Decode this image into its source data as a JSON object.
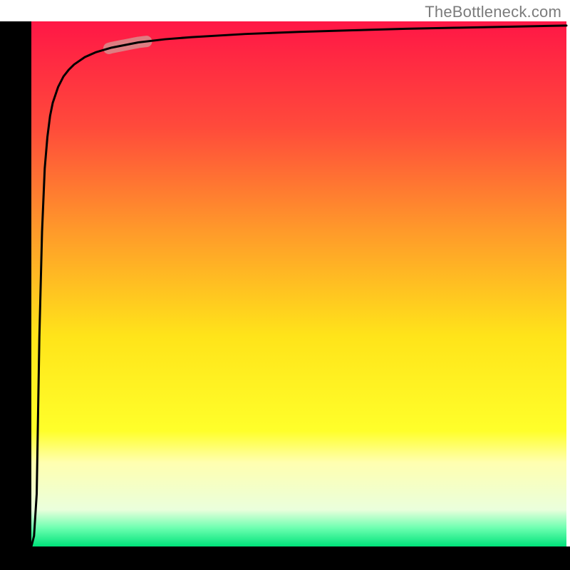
{
  "attribution": "TheBottleneck.com",
  "chart_data": {
    "type": "line",
    "title": "",
    "xlabel": "",
    "ylabel": "",
    "xlim": [
      0,
      100
    ],
    "ylim": [
      0,
      100
    ],
    "x": [
      0.0,
      0.5,
      1.0,
      1.5,
      2.0,
      2.5,
      3.0,
      3.5,
      4.0,
      5.0,
      6.0,
      7.0,
      8.0,
      10.0,
      12.0,
      15.0,
      20.0,
      25.0,
      30.0,
      40.0,
      50.0,
      60.0,
      70.0,
      80.0,
      90.0,
      100.0
    ],
    "y": [
      0.0,
      2.0,
      10.0,
      40.0,
      60.0,
      72.0,
      78.0,
      82.0,
      84.5,
      87.5,
      89.5,
      90.8,
      91.8,
      93.2,
      94.1,
      95.0,
      96.0,
      96.6,
      97.0,
      97.6,
      98.0,
      98.3,
      98.6,
      98.8,
      99.0,
      99.2
    ],
    "highlight_segment": {
      "x_start": 14.5,
      "x_end": 21.5
    },
    "background_gradient": [
      {
        "pos": 0.0,
        "color": "#ff1746"
      },
      {
        "pos": 0.2,
        "color": "#ff4a3b"
      },
      {
        "pos": 0.4,
        "color": "#ff9a2a"
      },
      {
        "pos": 0.6,
        "color": "#ffe41a"
      },
      {
        "pos": 0.78,
        "color": "#ffff2a"
      },
      {
        "pos": 0.84,
        "color": "#ffffb0"
      },
      {
        "pos": 0.93,
        "color": "#eaffdc"
      },
      {
        "pos": 0.965,
        "color": "#6cffb0"
      },
      {
        "pos": 1.0,
        "color": "#00e27a"
      }
    ],
    "colors": {
      "axis": "#000000",
      "curve": "#000000",
      "highlight": "#d88d8d"
    }
  }
}
